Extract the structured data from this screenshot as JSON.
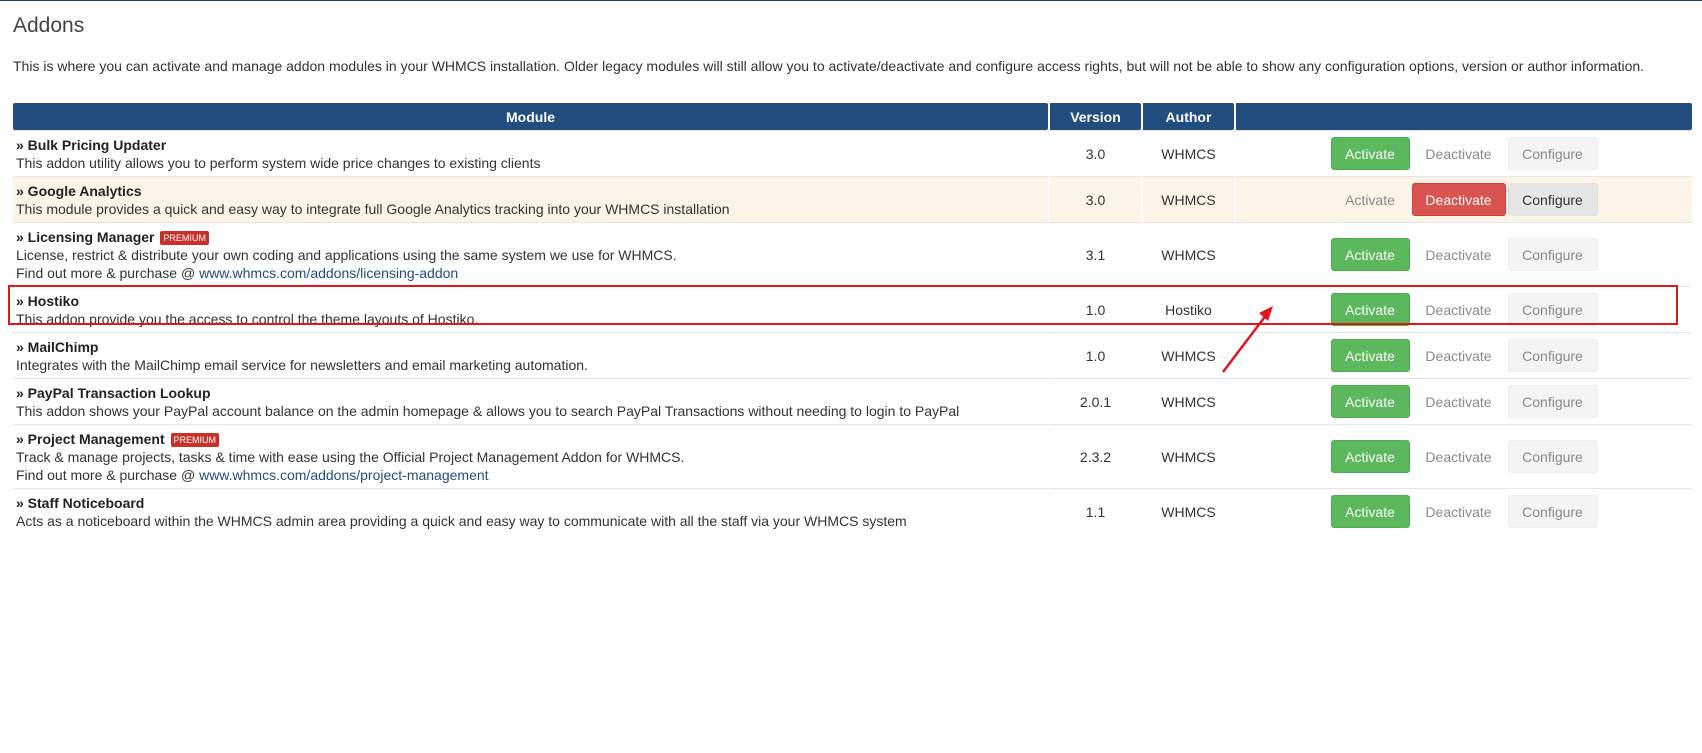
{
  "page": {
    "title": "Addons",
    "intro": "This is where you can activate and manage addon modules in your WHMCS installation. Older legacy modules will still allow you to activate/deactivate and configure access rights, but will not be able to show any configuration options, version or author information."
  },
  "table": {
    "headers": {
      "module": "Module",
      "version": "Version",
      "author": "Author",
      "actions": ""
    },
    "buttons": {
      "activate": "Activate",
      "deactivate": "Deactivate",
      "configure": "Configure"
    },
    "premium_label": "PREMIUM",
    "rows": [
      {
        "name": "» Bulk Pricing Updater",
        "description": "This addon utility allows you to perform system wide price changes to existing clients",
        "version": "3.0",
        "author": "WHMCS",
        "active": false
      },
      {
        "name": "» Google Analytics",
        "description": "This module provides a quick and easy way to integrate full Google Analytics tracking into your WHMCS installation",
        "version": "3.0",
        "author": "WHMCS",
        "active": true
      },
      {
        "name": "» Licensing Manager",
        "premium": true,
        "description": "License, restrict & distribute your own coding and applications using the same system we use for WHMCS.",
        "more_prefix": "Find out more & purchase @ ",
        "more_link": "www.whmcs.com/addons/licensing-addon",
        "version": "3.1",
        "author": "WHMCS",
        "active": false
      },
      {
        "name": "» Hostiko",
        "description": "This addon provide you the access to control the theme layouts of Hostiko.",
        "version": "1.0",
        "author": "Hostiko",
        "active": false
      },
      {
        "name": "» MailChimp",
        "description": "Integrates with the MailChimp email service for newsletters and email marketing automation.",
        "version": "1.0",
        "author": "WHMCS",
        "active": false
      },
      {
        "name": "» PayPal Transaction Lookup",
        "description": "This addon shows your PayPal account balance on the admin homepage & allows you to search PayPal Transactions without needing to login to PayPal",
        "version": "2.0.1",
        "author": "WHMCS",
        "active": false
      },
      {
        "name": "» Project Management",
        "premium": true,
        "description": "Track & manage projects, tasks & time with ease using the Official Project Management Addon for WHMCS.",
        "more_prefix": "Find out more & purchase @ ",
        "more_link": "www.whmcs.com/addons/project-management",
        "version": "2.3.2",
        "author": "WHMCS",
        "active": false
      },
      {
        "name": "» Staff Noticeboard",
        "description": "Acts as a noticeboard within the WHMCS admin area providing a quick and easy way to communicate with all the staff via your WHMCS system",
        "version": "1.1",
        "author": "WHMCS",
        "active": false
      }
    ]
  },
  "colors": {
    "header_bg": "#224d7f",
    "activate_green": "#5cb85c",
    "deactivate_red": "#d9534f",
    "annotation_red": "#e0161c",
    "active_row_bg": "#fdf4e8"
  }
}
